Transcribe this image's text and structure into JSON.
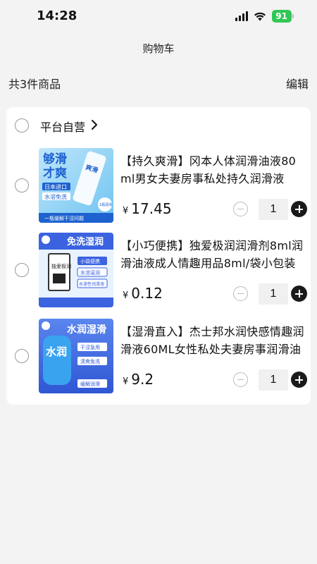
{
  "status_bar": {
    "time": "14:28",
    "battery": "91",
    "battery_color": "#2fc854"
  },
  "header": {
    "title": "购物车"
  },
  "summary": {
    "item_count": "共3件商品",
    "edit_label": "编辑"
  },
  "store": {
    "name": "平台自营",
    "chevron_icon": "chevron-right-icon"
  },
  "items": [
    {
      "title": "【持久爽滑】冈本人体润滑油液80ml男女夫妻房事私处持久润滑液",
      "currency": "¥",
      "price": "17.45",
      "quantity": "1",
      "thumb": {
        "line1": "够滑",
        "line2": "才爽",
        "tag1": "日本进口",
        "tag2": "水溶免洗",
        "badge": "1瓶润滑",
        "bottom": "一瓶缓解干涩问题",
        "bottle": "爽滑"
      }
    },
    {
      "title": "【小巧便携】独爱极润润滑剂8ml润滑油液成人情趣用品8ml/袋小包装",
      "currency": "¥",
      "price": "0.12",
      "quantity": "1",
      "thumb": {
        "banner": "免洗湿润",
        "pack": "独爱极润",
        "tag1": "小袋便携",
        "tag2": "水溶温润",
        "tag3": "水溶性润滑液"
      }
    },
    {
      "title": "【湿滑直入】杰士邦水润快感情趣润滑液60ML女性私处夫妻房事润滑油",
      "currency": "¥",
      "price": "9.2",
      "quantity": "1",
      "thumb": {
        "banner": "水润湿滑",
        "bottle": "水润",
        "tag1": "干涩急用",
        "tag2": "清爽免洗",
        "tag3": "缓解润滑"
      }
    }
  ],
  "colors": {
    "background": "#f3f3f3",
    "card": "#ffffff",
    "plus_button": "#1a1a1a",
    "thumb_blue": "#3b63e0"
  }
}
